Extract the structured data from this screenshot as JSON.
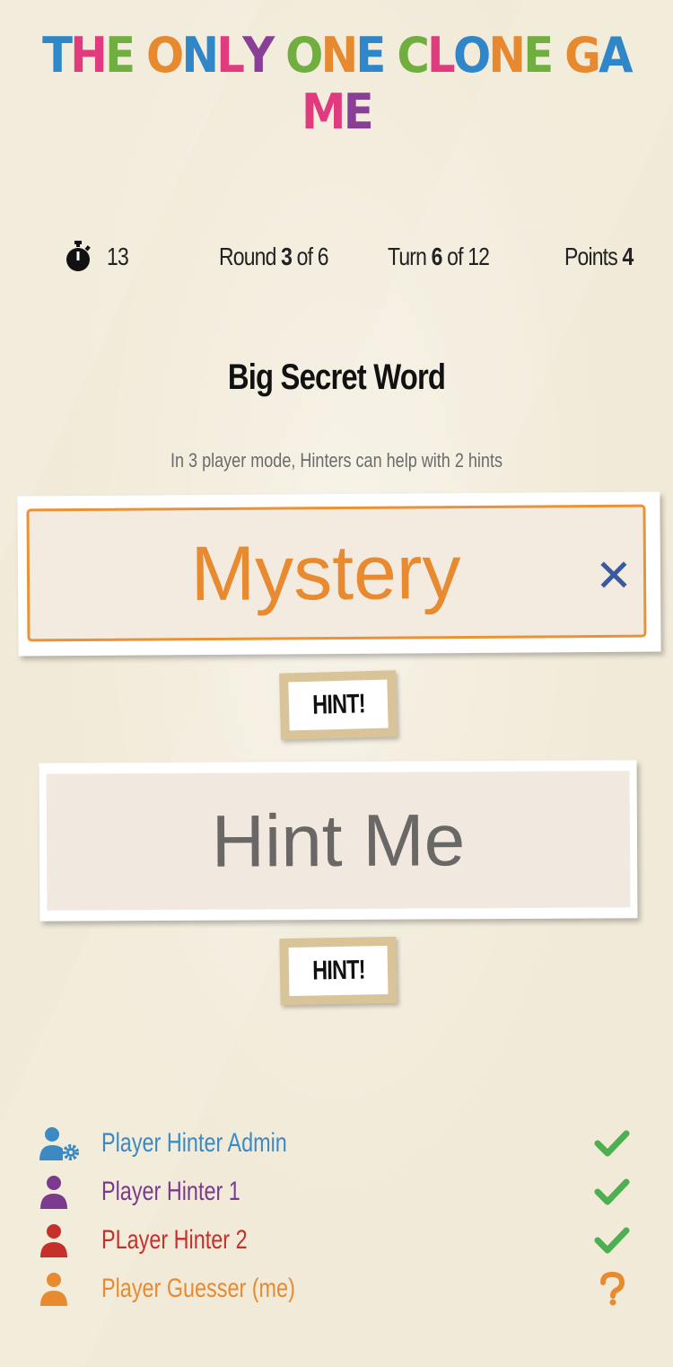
{
  "app": {
    "title_letters": [
      "T",
      "H",
      "E",
      " ",
      "O",
      "N",
      "L",
      "Y",
      " ",
      "O",
      "N",
      "E",
      " ",
      "C",
      "L",
      "O",
      "N",
      "E",
      " ",
      "G",
      "A",
      "M",
      "E"
    ],
    "title_colors": [
      "#2f86c8",
      "#e23a7e",
      "#6fae3f",
      "",
      "#e7892f",
      "#2f86c8",
      "#e23a7e",
      "#8a3f97",
      "",
      "#6fae3f",
      "#e7892f",
      "#2f86c8",
      "",
      "#6fae3f",
      "#e23a7e",
      "#2f86c8",
      "#e7892f",
      "#6fae3f",
      "",
      "#e7892f",
      "#2f86c8",
      "#e23a7e",
      "#8a3f97"
    ]
  },
  "stats": {
    "timer": "13",
    "round_prefix": "Round ",
    "round_current": "3",
    "round_sep": " of 6",
    "turn_prefix": "Turn ",
    "turn_current": "6",
    "turn_sep": " of 12",
    "points_prefix": "Points ",
    "points_value": "4"
  },
  "secret": {
    "heading": "Big Secret Word",
    "mode_note": "In 3 player mode, Hinters can help with 2 hints"
  },
  "hints": [
    {
      "value": "Mystery",
      "button_label": "HINT!"
    },
    {
      "value": "Hint Me",
      "button_label": "HINT!"
    }
  ],
  "players": [
    {
      "name": "Player Hinter Admin",
      "color": "#3b8ac4",
      "icon": "user-gear-icon",
      "status": "check-icon"
    },
    {
      "name": "Player Hinter 1",
      "color": "#7c3a8e",
      "icon": "user-icon",
      "status": "check-icon"
    },
    {
      "name": "PLayer Hinter 2",
      "color": "#c5302a",
      "icon": "user-icon",
      "status": "check-icon"
    },
    {
      "name": "Player Guesser (me)",
      "color": "#e88a2f",
      "icon": "user-icon",
      "status": "question-icon"
    }
  ],
  "colors": {
    "check": "#4caf50",
    "question": "#e88a2f",
    "clear_icon": "#3a5aa0"
  }
}
